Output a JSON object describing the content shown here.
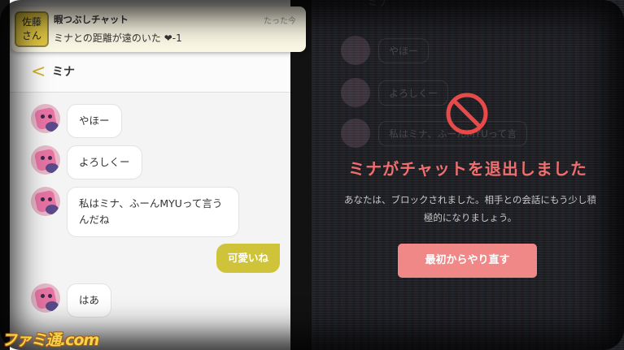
{
  "notification": {
    "icon_text": "佐藤\nさん",
    "app_name": "暇つぶしチャット",
    "time": "たった今",
    "body": "ミナとの距離が遠のいた ❤-1"
  },
  "chat": {
    "partner_name": "ミナ",
    "messages": [
      {
        "from": "partner",
        "text": "やほー"
      },
      {
        "from": "partner",
        "text": "よろしくー"
      },
      {
        "from": "partner",
        "text": "私はミナ、ふーんMYUって言うんだね"
      },
      {
        "from": "me",
        "text": "可愛いね"
      },
      {
        "from": "partner",
        "text": "はあ"
      }
    ]
  },
  "overlay": {
    "ghost_title": "ミナ",
    "ghost_messages": [
      "やほー",
      "よろしくー",
      "私はミナ、ふーんMYUって言"
    ],
    "title": "ミナがチャットを退出しました",
    "description": "あなたは、ブロックされました。相手との会話にもう少し積極的になりましょう。",
    "restart_button": "最初からやり直す"
  },
  "watermark": "ファミ通.com",
  "colors": {
    "accent_yellow": "#cfc33a",
    "alert_red": "#f06e6e",
    "button_red": "#f08888"
  }
}
